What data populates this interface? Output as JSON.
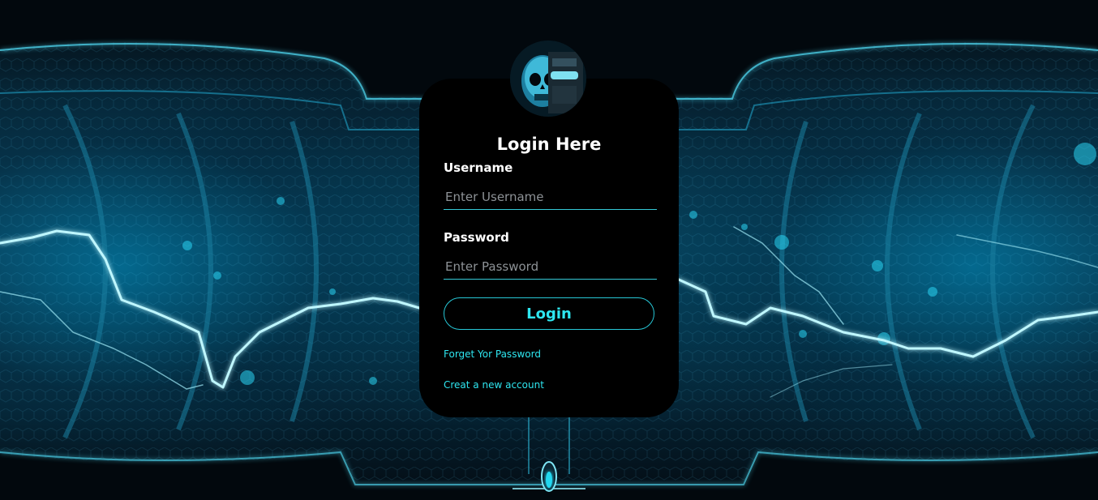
{
  "form": {
    "title": "Login Here",
    "username_label": "Username",
    "username_placeholder": "Enter Username",
    "password_label": "Password",
    "password_placeholder": "Enter Password",
    "login_button": "Login",
    "forgot_link": "Forget Yor Password",
    "create_link": "Creat a new account"
  },
  "colors": {
    "accent": "#2ee6f0",
    "card_background": "#000000",
    "text": "#ffffff",
    "placeholder": "#8d9296"
  },
  "icons": {
    "avatar": "skull-avatar-icon"
  }
}
